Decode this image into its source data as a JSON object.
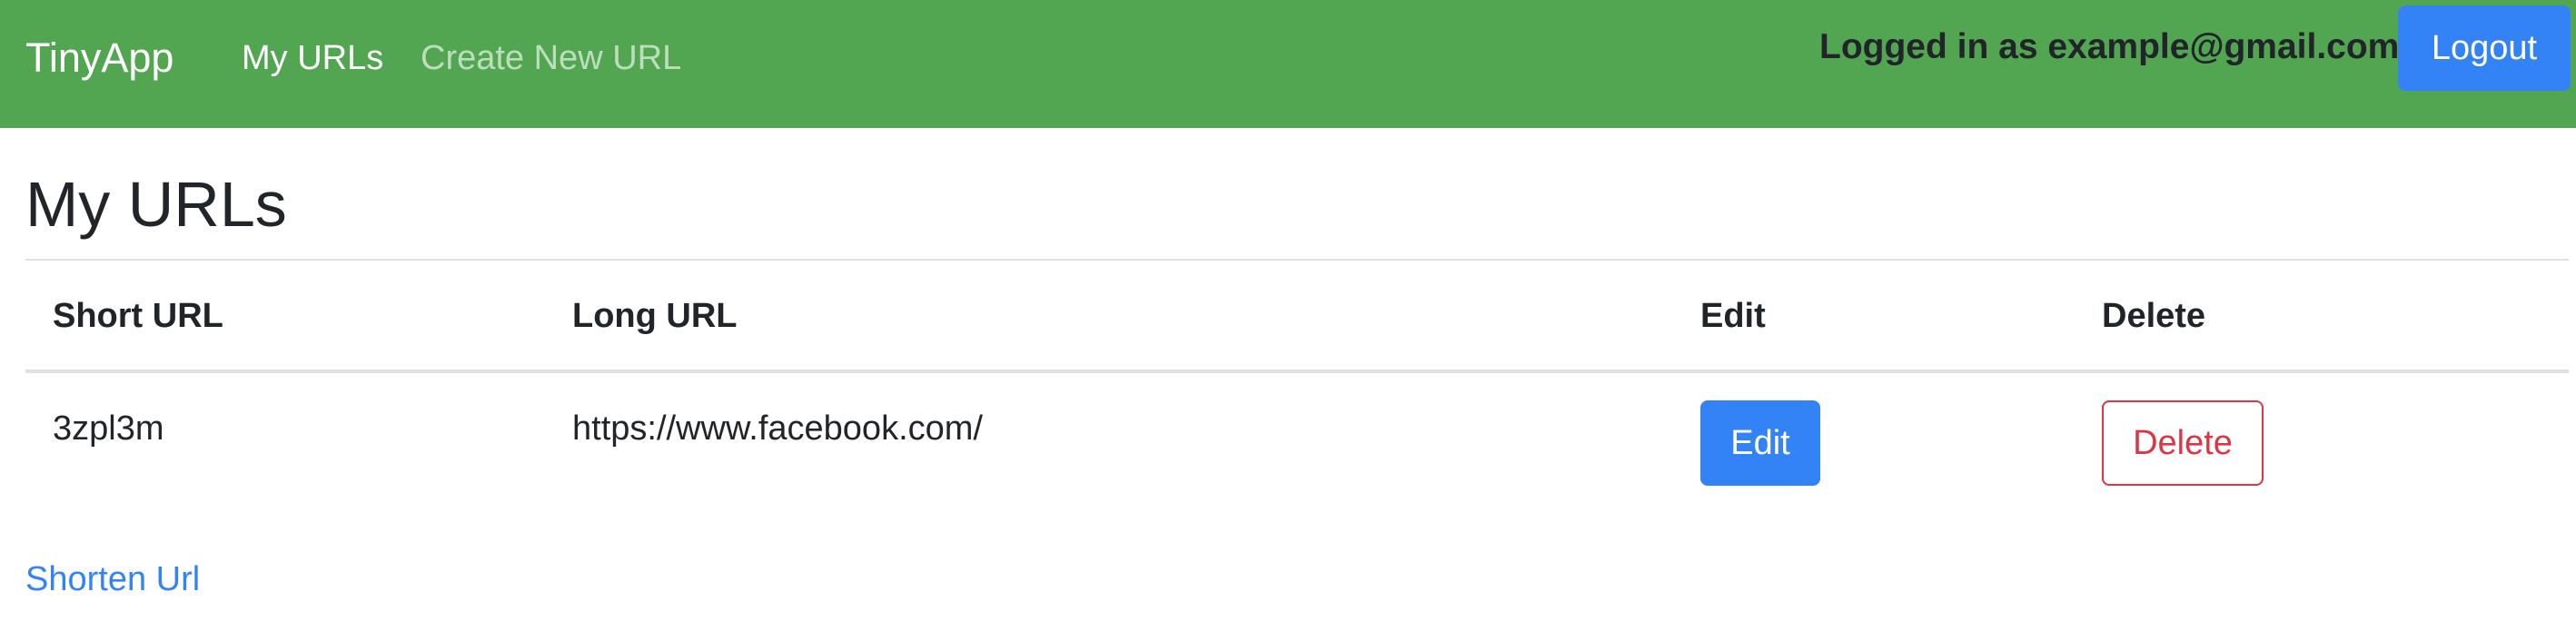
{
  "colors": {
    "navbar_bg": "#52a651",
    "primary": "#3483f6",
    "danger": "#dc3545",
    "text": "#212529"
  },
  "navbar": {
    "brand": "TinyApp",
    "links": [
      {
        "label": "My URLs",
        "active": true
      },
      {
        "label": "Create New URL",
        "active": false
      }
    ],
    "logged_in_text": "Logged in as example@gmail.com",
    "logout_label": "Logout"
  },
  "main": {
    "title": "My URLs",
    "table": {
      "headers": [
        "Short URL",
        "Long URL",
        "Edit",
        "Delete"
      ],
      "rows": [
        {
          "short_url": "3zpl3m",
          "long_url": "https://www.facebook.com/",
          "edit_label": "Edit",
          "delete_label": "Delete"
        }
      ]
    },
    "shorten_link": "Shorten Url"
  }
}
